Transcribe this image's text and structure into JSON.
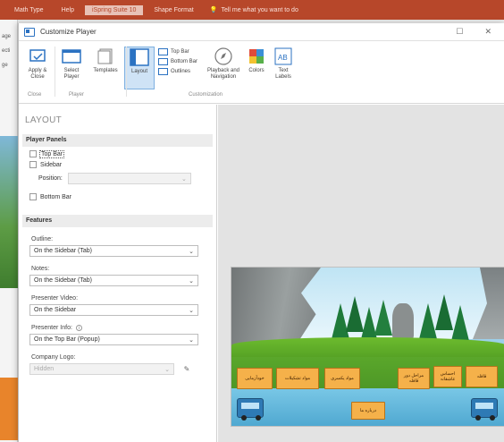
{
  "host_app": {
    "tabs": [
      "Math Type",
      "Help",
      "iSpring Suite 10",
      "Shape Format"
    ],
    "active_tab": "iSpring Suite 10",
    "tell_me": "Tell me what you want to do",
    "left_fragments": [
      "age",
      "ecti",
      "ge"
    ]
  },
  "dialog": {
    "title": "Customize Player",
    "restore_glyph": "☐",
    "close_glyph": "✕"
  },
  "ribbon": {
    "apply_close": "Apply & Close",
    "select_player": "Select Player",
    "templates": "Templates",
    "layout": "Layout",
    "top_bar": "Top Bar",
    "bottom_bar": "Bottom Bar",
    "outlines": "Outlines",
    "playback": "Playback and Navigation",
    "colors": "Colors",
    "text_labels": "Text Labels",
    "group_close": "Close",
    "group_player": "Player",
    "group_customization": "Customization"
  },
  "panel": {
    "title": "LAYOUT",
    "player_panels": {
      "header": "Player Panels",
      "top_bar": "Top Bar",
      "sidebar": "Sidebar",
      "position_label": "Position:",
      "position_value": "",
      "bottom_bar": "Bottom Bar"
    },
    "features": {
      "header": "Features",
      "outline_label": "Outline:",
      "outline_value": "On the Sidebar (Tab)",
      "notes_label": "Notes:",
      "notes_value": "On the Sidebar (Tab)",
      "presenter_video_label": "Presenter Video:",
      "presenter_video_value": "On the Sidebar",
      "presenter_info_label": "Presenter Info:",
      "presenter_info_value": "On the Top Bar (Popup)",
      "company_logo_label": "Company Logo:",
      "company_logo_value": "Hidden"
    }
  },
  "slide": {
    "buttons": [
      "قافلہ",
      "احساس عاشقانہ",
      "مراحل دور قافلہ",
      "مواد یکسری",
      "مواد تشکیلات",
      "خودآزمایی"
    ],
    "center_button": "درباره ما"
  },
  "colors": {
    "host_accent": "#b7472a",
    "selection": "#cfe3f6",
    "slide_button": "#f5b14a"
  }
}
